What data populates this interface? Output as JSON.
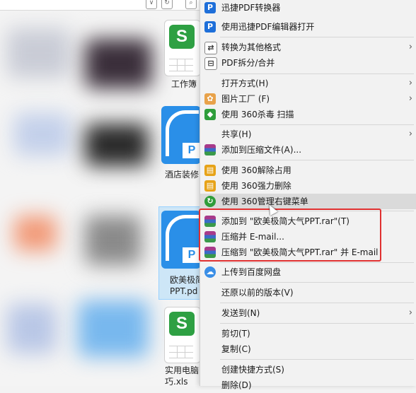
{
  "files": [
    {
      "name": "工作簿",
      "type": "xls"
    },
    {
      "name": "酒店装修",
      "type": "pdf"
    },
    {
      "name_line1": "欧美极简",
      "name_line2": "PPT.pd",
      "type": "pdf",
      "selected": true
    },
    {
      "name_line1": "实用电脑",
      "name_line2": "巧.xls",
      "type": "xls"
    }
  ],
  "menu": {
    "items": [
      {
        "label": "迅捷PDF转换器",
        "icon": "pdf-converter-icon",
        "color": "#1e6fd9"
      },
      {
        "label": "使用迅捷PDF编辑器打开",
        "icon": "pdf-editor-icon",
        "color": "#1e6fd9"
      },
      {
        "label": "转换为其他格式",
        "icon": "convert-icon",
        "has_submenu": true
      },
      {
        "label": "PDF拆分/合并",
        "icon": "split-merge-icon"
      },
      {
        "label": "打开方式(H)",
        "has_submenu": true
      },
      {
        "label": "图片工厂 (F)",
        "icon": "picture-factory-icon",
        "has_submenu": true
      },
      {
        "label": "使用 360杀毒 扫描",
        "icon": "360-antivirus-icon",
        "color": "#2e9d3a"
      },
      {
        "label": "共享(H)",
        "has_submenu": true
      },
      {
        "label": "添加到压缩文件(A)...",
        "icon": "winrar-icon"
      },
      {
        "label": "使用 360解除占用",
        "icon": "360-unlock-icon",
        "color": "#e7a318"
      },
      {
        "label": "使用 360强力删除",
        "icon": "360-shred-icon",
        "color": "#e7a318"
      },
      {
        "label": "使用 360管理右键菜单",
        "icon": "360-menu-icon",
        "color": "#2e9d3a",
        "hover": true
      },
      {
        "label": "添加到 \"欧美极简大气PPT.rar\"(T)",
        "icon": "winrar-icon"
      },
      {
        "label": "压缩并 E-mail...",
        "icon": "winrar-icon"
      },
      {
        "label": "压缩到 \"欧美极简大气PPT.rar\" 并 E-mail",
        "icon": "winrar-icon"
      },
      {
        "label": "上传到百度网盘",
        "icon": "baidu-netdisk-icon",
        "color": "#3a8ee6"
      },
      {
        "label": "还原以前的版本(V)"
      },
      {
        "label": "发送到(N)",
        "has_submenu": true
      },
      {
        "label": "剪切(T)"
      },
      {
        "label": "复制(C)"
      },
      {
        "label": "创建快捷方式(S)"
      },
      {
        "label": "删除(D)"
      }
    ],
    "arrow": "›",
    "highlight_color": "#e03030"
  }
}
